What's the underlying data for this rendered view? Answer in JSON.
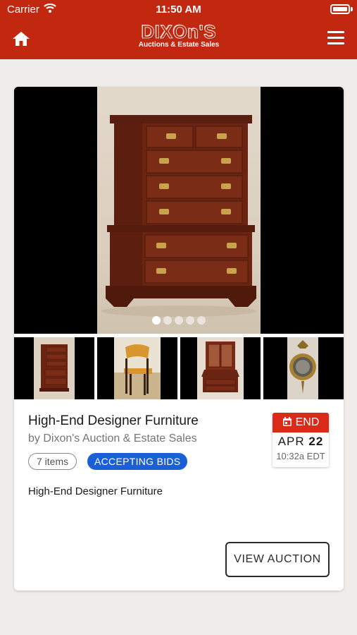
{
  "status_bar": {
    "carrier": "Carrier",
    "time": "11:50 AM"
  },
  "header": {
    "logo_main": "DIXOn'S",
    "logo_sub": "Auctions & Estate Sales",
    "brand_color": "#c2270f"
  },
  "auction": {
    "title": "High-End Designer Furniture",
    "byline": "by Dixon's Auction & Estate Sales",
    "items_badge": "7 items",
    "status_badge": "ACCEPTING BIDS",
    "description": "High-End Designer Furniture",
    "end_label": "END",
    "end_month": "APR",
    "end_day": "22",
    "end_time": "10:32a EDT",
    "view_button": "VIEW AUCTION",
    "slide_count": 5,
    "active_slide": 1,
    "thumbnails": [
      "chest-of-drawers",
      "wooden-chair",
      "secretary-desk",
      "convex-mirror"
    ],
    "status_color": "#1b5fd6",
    "end_color": "#d92a1a"
  }
}
